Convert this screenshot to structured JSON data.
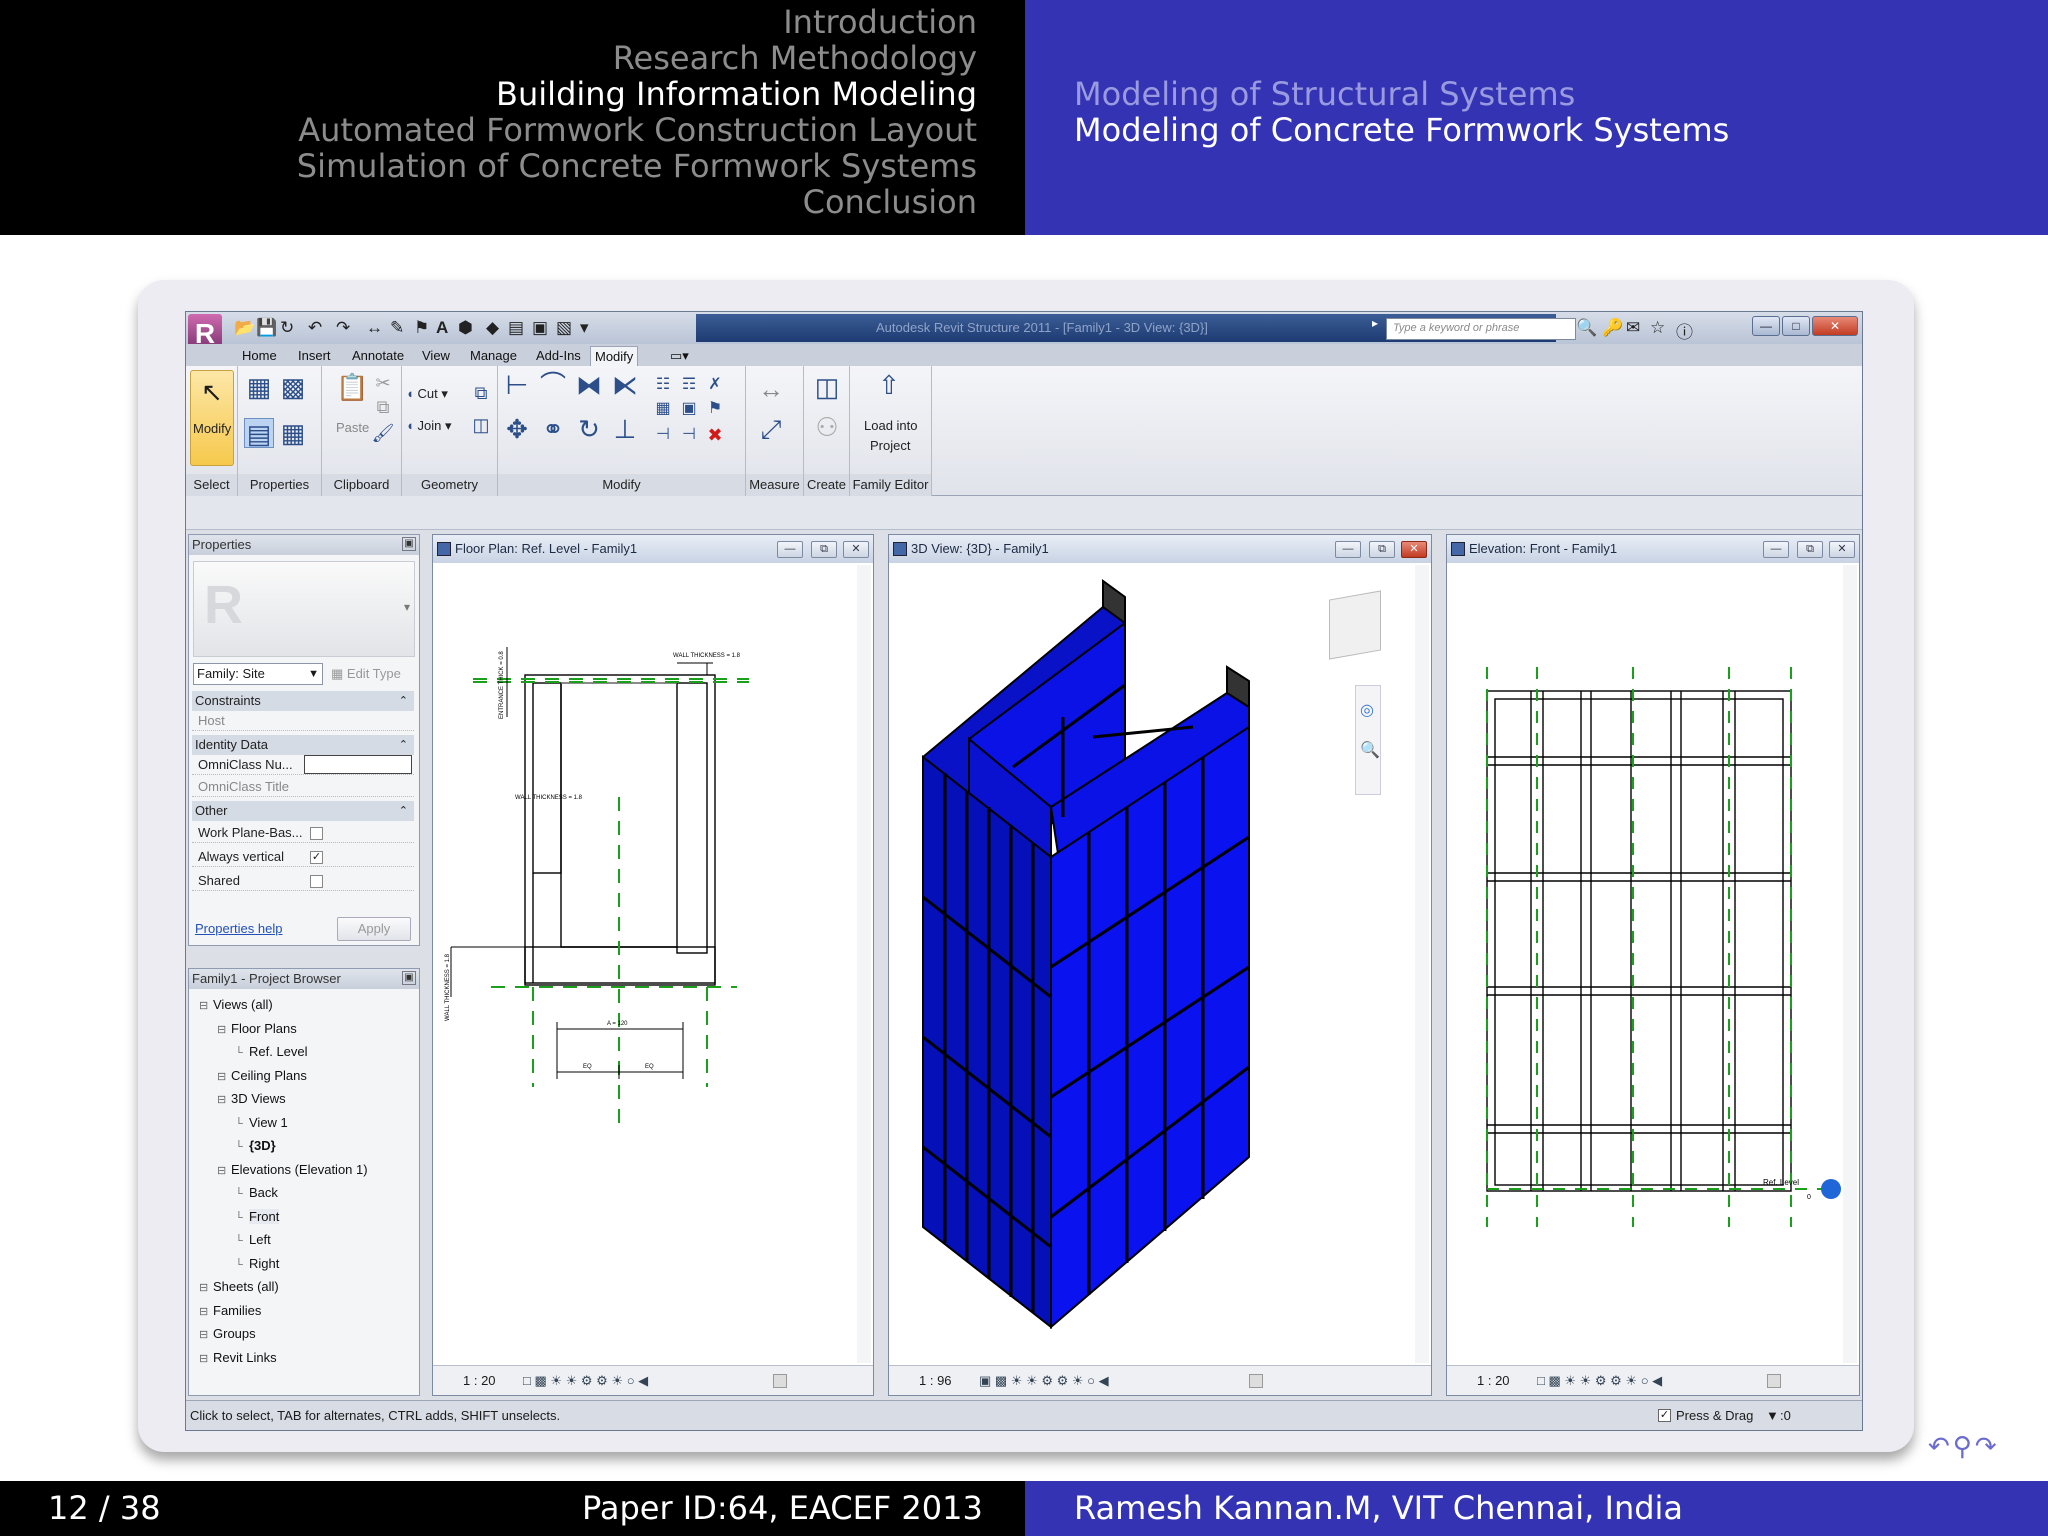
{
  "header": {
    "sections": [
      {
        "label": "Introduction",
        "current": false
      },
      {
        "label": "Research Methodology",
        "current": false
      },
      {
        "label": "Building Information Modeling",
        "current": true
      },
      {
        "label": "Automated Formwork Construction Layout",
        "current": false
      },
      {
        "label": "Simulation of Concrete Formwork Systems",
        "current": false
      },
      {
        "label": "Conclusion",
        "current": false
      }
    ],
    "subsections": [
      {
        "label": "Modeling of Structural Systems",
        "current": false
      },
      {
        "label": "Modeling of Concrete Formwork Systems",
        "current": true
      }
    ]
  },
  "footer": {
    "page": "12 / 38",
    "paper": "Paper ID:64, EACEF 2013",
    "author": "Ramesh Kannan.M, VIT Chennai, India"
  },
  "revit": {
    "title": "Autodesk Revit Structure 2011 - [Family1 - 3D View: {3D}]",
    "search_placeholder": "Type a keyword or phrase",
    "tabs": [
      "Home",
      "Insert",
      "Annotate",
      "View",
      "Manage",
      "Add-Ins",
      "Modify"
    ],
    "active_tab": "Modify",
    "ribbon": {
      "modify_label": "Modify",
      "cut_label": "Cut",
      "join_label": "Join",
      "paste_label": "Paste",
      "load_into_label": "Load into",
      "project_label": "Project",
      "groups": [
        "Select",
        "Properties",
        "Clipboard",
        "Geometry",
        "Modify",
        "Measure",
        "Create",
        "Family Editor"
      ]
    },
    "properties": {
      "title": "Properties",
      "family_select": "Family: Site",
      "edit_type": "Edit Type",
      "sections": [
        {
          "name": "Constraints",
          "rows": [
            "Host"
          ]
        },
        {
          "name": "Identity Data",
          "rows": [
            "OmniClass Nu...",
            "OmniClass Title"
          ]
        },
        {
          "name": "Other",
          "rows": [
            "Work Plane-Bas...",
            "Always vertical",
            "Shared"
          ]
        }
      ],
      "checked": [
        false,
        true,
        false
      ],
      "help_link": "Properties help",
      "apply": "Apply"
    },
    "browser": {
      "title": "Family1 - Project Browser",
      "items": [
        {
          "label": "Views (all)",
          "indent": 0
        },
        {
          "label": "Floor Plans",
          "indent": 1
        },
        {
          "label": "Ref. Level",
          "indent": 2
        },
        {
          "label": "Ceiling Plans",
          "indent": 1
        },
        {
          "label": "3D Views",
          "indent": 1
        },
        {
          "label": "View 1",
          "indent": 2
        },
        {
          "label": "{3D}",
          "indent": 2
        },
        {
          "label": "Elevations (Elevation 1)",
          "indent": 1
        },
        {
          "label": "Back",
          "indent": 2
        },
        {
          "label": "Front",
          "indent": 2
        },
        {
          "label": "Left",
          "indent": 2
        },
        {
          "label": "Right",
          "indent": 2
        },
        {
          "label": "Sheets (all)",
          "indent": 0
        },
        {
          "label": "Families",
          "indent": 0
        },
        {
          "label": "Groups",
          "indent": 0
        },
        {
          "label": "Revit Links",
          "indent": 0
        }
      ]
    },
    "views": {
      "floor_plan": {
        "title": "Floor Plan: Ref. Level - Family1",
        "scale": "1 : 20",
        "dims": [
          "WALL THICKNESS = 1.8",
          "WALL THICKNESS = 1.8",
          "ENTRANCE THICK = 0.8",
          "WALL THICKNESS = 1.8",
          "A = 120",
          "EQ",
          "EQ"
        ]
      },
      "view_3d": {
        "title": "3D View: {3D} - Family1",
        "scale": "1 : 96"
      },
      "elevation": {
        "title": "Elevation: Front - Family1",
        "scale": "1 : 20",
        "level_label": "Ref. Level",
        "level_value": "0"
      }
    },
    "status": {
      "hint": "Click to select, TAB for alternates, CTRL adds, SHIFT unselects.",
      "press_drag": "Press & Drag",
      "filter_count": ":0"
    },
    "colors": {
      "formwork_blue": "#0a12e6",
      "accent_green": "#1aa01a"
    }
  }
}
